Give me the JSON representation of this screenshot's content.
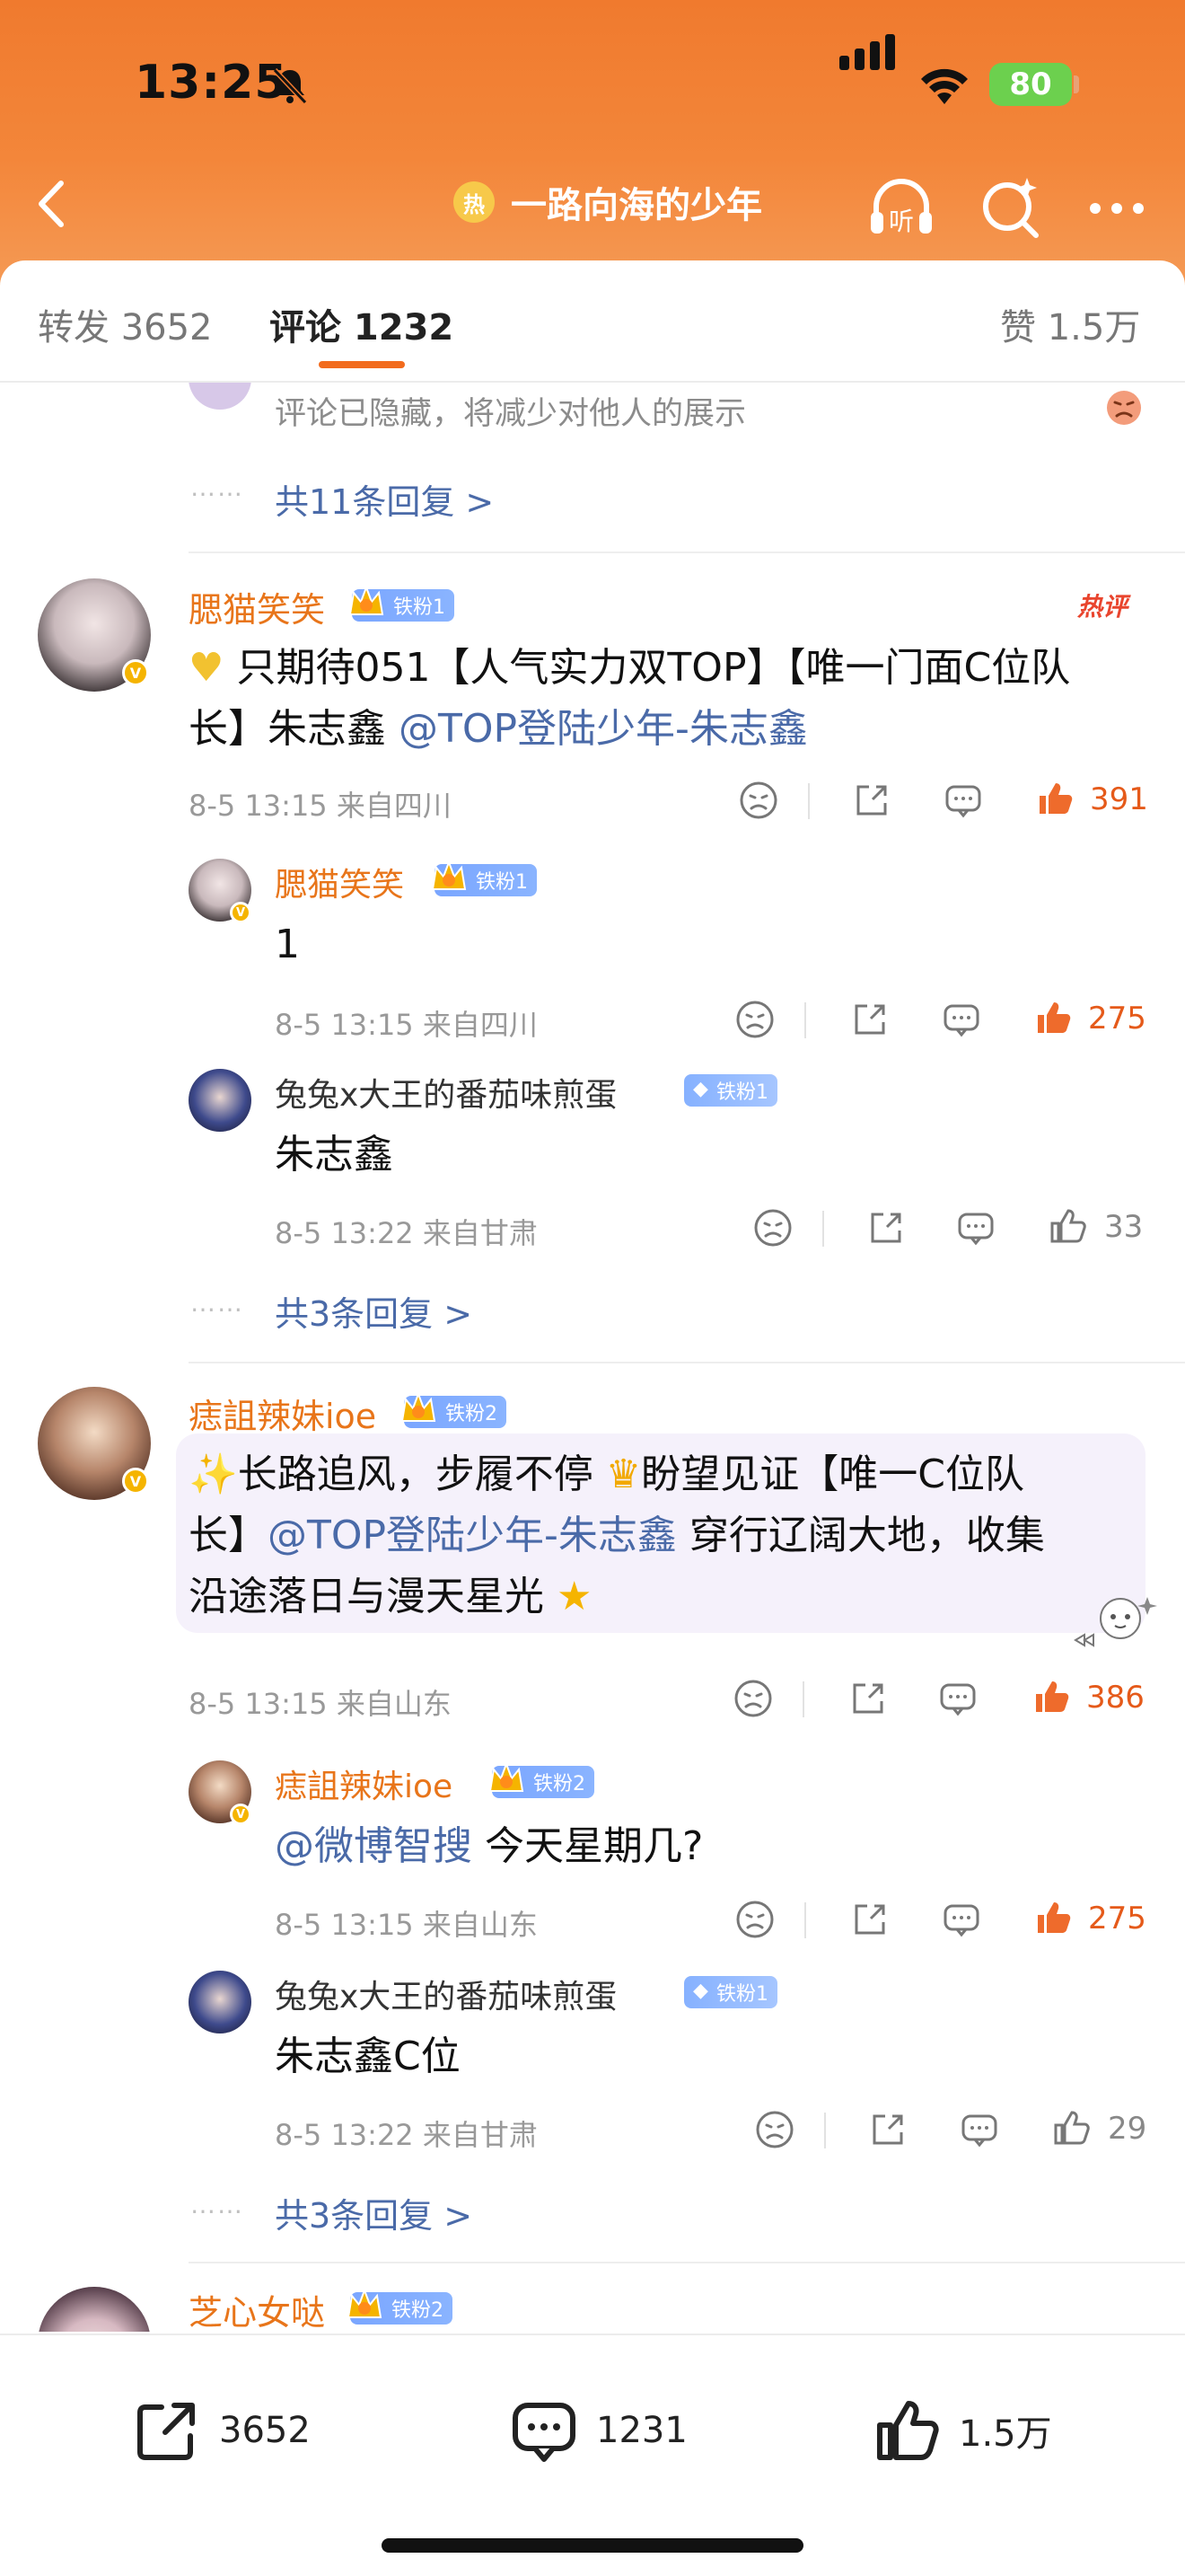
{
  "status_bar": {
    "time": "13:25",
    "battery": "80"
  },
  "nav": {
    "hot_label": "热",
    "title": "一路向海的少年",
    "listen_label": "听"
  },
  "tabs": {
    "repost": "转发 3652",
    "comments": "评论 1232",
    "likes": "赞 1.5万"
  },
  "top_collapsed": {
    "hidden_note": "评论已隐藏，将减少对他人的展示",
    "more_dots": "……",
    "more_replies": "共11条回复 >"
  },
  "comments": [
    {
      "user": "腮猫笑笑",
      "fan_badge": "铁粉1",
      "hot_tag": "热评",
      "line1_prefix": "只期待051【人气实力双TOP】【唯一门面C位队",
      "line2_prefix": "长】朱志鑫 ",
      "line2_mention": "@TOP登陆少年-朱志鑫",
      "meta": "8-5 13:15  来自四川",
      "likes": "391",
      "replies": [
        {
          "user": "腮猫笑笑",
          "fan_badge": "铁粉1",
          "text": "1",
          "meta": "8-5 13:15  来自四川",
          "likes": "275"
        },
        {
          "user": "兔兔x大王的番茄味煎蛋",
          "fan_badge": "铁粉1",
          "text": "朱志鑫",
          "meta": "8-5 13:22  来自甘肃",
          "likes": "33"
        }
      ],
      "more_dots": "……",
      "more_replies": "共3条回复 >"
    },
    {
      "user": "痣詛辣妹ioe",
      "fan_badge": "铁粉2",
      "line1": "长路追风，步履不停",
      "line1_b": "盼望见证【唯一C位队",
      "line2_prefix": "长】",
      "line2_mention": "@TOP登陆少年-朱志鑫",
      "line2_suffix": " 穿行辽阔大地，收集",
      "line3": "沿途落日与漫天星光",
      "meta": "8-5 13:15  来自山东",
      "likes": "386",
      "replies": [
        {
          "user": "痣詛辣妹ioe",
          "fan_badge": "铁粉2",
          "mention": "@微博智搜",
          "text": " 今天星期几?",
          "meta": "8-5 13:15  来自山东",
          "likes": "275"
        },
        {
          "user": "兔兔x大王的番茄味煎蛋",
          "fan_badge": "铁粉1",
          "text": "朱志鑫C位",
          "meta": "8-5 13:22  来自甘肃",
          "likes": "29"
        }
      ],
      "more_dots": "……",
      "more_replies": "共3条回复 >"
    },
    {
      "user": "芝心女哒",
      "fan_badge": "铁粉2"
    }
  ],
  "bottom_bar": {
    "repost": "3652",
    "comment": "1231",
    "like": "1.5万"
  },
  "colors": {
    "header": "#f07a2e",
    "accent": "#f26b1d",
    "username": "#e8751a",
    "mention": "#4a6aa8",
    "hot_like": "#e55a1a"
  }
}
